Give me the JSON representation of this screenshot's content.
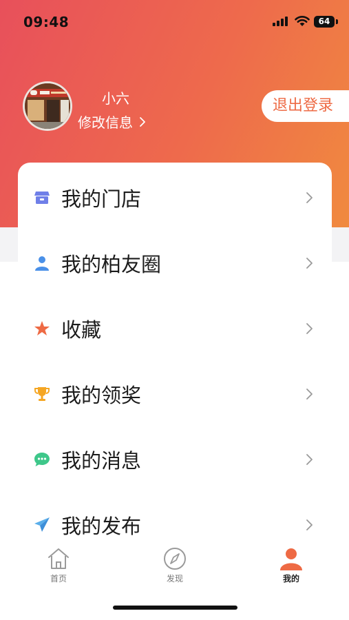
{
  "status_bar": {
    "time": "09:48",
    "battery": "64"
  },
  "profile": {
    "username": "小六",
    "edit_label": "修改信息",
    "logout_label": "退出登录"
  },
  "menu": {
    "items": [
      {
        "label": "我的门店",
        "icon": "store-icon"
      },
      {
        "label": "我的柏友圈",
        "icon": "person-icon"
      },
      {
        "label": "收藏",
        "icon": "star-icon"
      },
      {
        "label": "我的领奖",
        "icon": "trophy-icon"
      },
      {
        "label": "我的消息",
        "icon": "chat-bubble-icon"
      },
      {
        "label": "我的发布",
        "icon": "paper-plane-icon"
      }
    ]
  },
  "tabs": [
    {
      "label": "首页",
      "icon": "home-icon",
      "active": false
    },
    {
      "label": "发现",
      "icon": "compass-icon",
      "active": false
    },
    {
      "label": "我的",
      "icon": "user-icon",
      "active": true
    }
  ],
  "colors": {
    "accent": "#ee6a44",
    "gradient_start": "#e8505b",
    "gradient_end": "#f08a3f"
  }
}
